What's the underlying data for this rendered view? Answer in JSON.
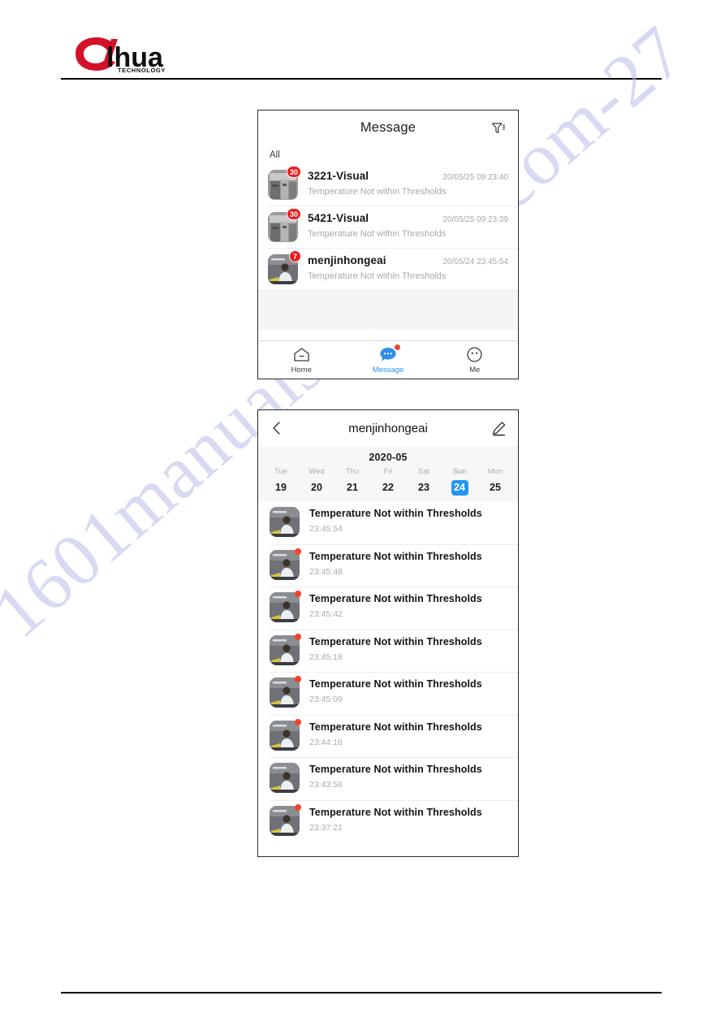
{
  "document": {
    "brand": "alhua",
    "brand_sub": "TECHNOLOGY",
    "watermark": "1601manualsarchive.com-27"
  },
  "message_screen": {
    "title": "Message",
    "filter_icon": "filter-icon",
    "section_label": "All",
    "items": [
      {
        "name": "3221-Visual",
        "time": "20/05/25 09:23:40",
        "subtitle": "Temperature Not within Thresholds",
        "badge": "30",
        "thumb": "industrial-machine-thumbnail"
      },
      {
        "name": "5421-Visual",
        "time": "20/05/25 09:23:39",
        "subtitle": "Temperature Not within Thresholds",
        "badge": "30",
        "thumb": "industrial-machine-thumbnail"
      },
      {
        "name": "menjinhongeai",
        "time": "20/05/24 23:45:54",
        "subtitle": "Temperature Not within Thresholds",
        "badge": "7",
        "thumb": "person-at-desk-thumbnail"
      }
    ],
    "tabs": [
      {
        "label": "Home",
        "icon": "home-icon",
        "active": false,
        "dot": false
      },
      {
        "label": "Message",
        "icon": "message-bubble-icon",
        "active": true,
        "dot": true
      },
      {
        "label": "Me",
        "icon": "profile-face-icon",
        "active": false,
        "dot": false
      }
    ],
    "accent_color": "#2f8fe8",
    "badge_color": "#e61f1f"
  },
  "detail_screen": {
    "title": "menjinhongeai",
    "back_icon": "chevron-left-icon",
    "edit_icon": "pencil-edit-icon",
    "calendar": {
      "month": "2020-05",
      "selected_color": "#2196f3",
      "days": [
        {
          "dow": "Tue",
          "num": "19",
          "selected": false
        },
        {
          "dow": "Wed",
          "num": "20",
          "selected": false
        },
        {
          "dow": "Thu",
          "num": "21",
          "selected": false
        },
        {
          "dow": "Fri",
          "num": "22",
          "selected": false
        },
        {
          "dow": "Sat",
          "num": "23",
          "selected": false
        },
        {
          "dow": "Sun",
          "num": "24",
          "selected": true
        },
        {
          "dow": "Mon",
          "num": "25",
          "selected": false
        }
      ]
    },
    "events": [
      {
        "title": "Temperature Not within Thresholds",
        "time": "23:45:54",
        "unread": false
      },
      {
        "title": "Temperature Not within Thresholds",
        "time": "23:45:48",
        "unread": true
      },
      {
        "title": "Temperature Not within Thresholds",
        "time": "23:45:42",
        "unread": true
      },
      {
        "title": "Temperature Not within Thresholds",
        "time": "23:45:18",
        "unread": true
      },
      {
        "title": "Temperature Not within Thresholds",
        "time": "23:45:09",
        "unread": true
      },
      {
        "title": "Temperature Not within Thresholds",
        "time": "23:44:16",
        "unread": true
      },
      {
        "title": "Temperature Not within Thresholds",
        "time": "23:43:56",
        "unread": false
      },
      {
        "title": "Temperature Not within Thresholds",
        "time": "23:37:21",
        "unread": true
      }
    ]
  }
}
